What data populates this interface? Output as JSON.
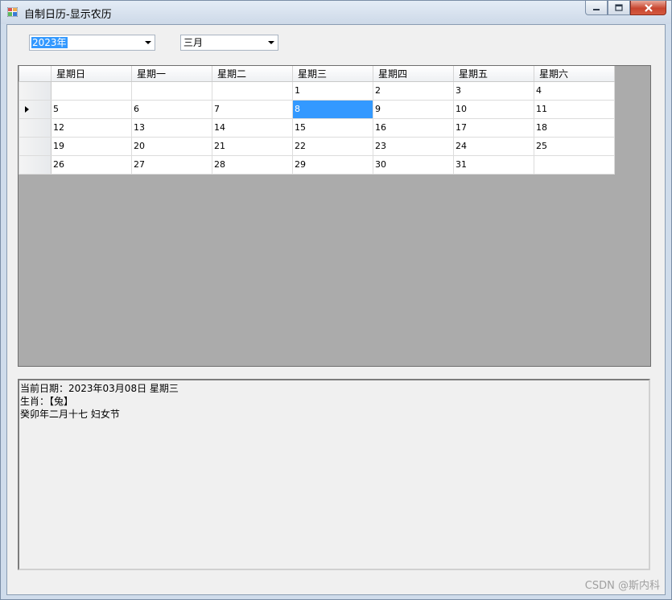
{
  "window": {
    "title": "自制日历-显示农历",
    "controls": {
      "minimize_icon": "minimize-icon",
      "maximize_icon": "maximize-icon",
      "close_icon": "close-icon"
    }
  },
  "year_combo": {
    "value": "2023年"
  },
  "month_combo": {
    "value": "三月"
  },
  "calendar": {
    "headers": [
      "星期日",
      "星期一",
      "星期二",
      "星期三",
      "星期四",
      "星期五",
      "星期六"
    ],
    "rows": [
      [
        "",
        "",
        "",
        "1",
        "2",
        "3",
        "4"
      ],
      [
        "5",
        "6",
        "7",
        "8",
        "9",
        "10",
        "11"
      ],
      [
        "12",
        "13",
        "14",
        "15",
        "16",
        "17",
        "18"
      ],
      [
        "19",
        "20",
        "21",
        "22",
        "23",
        "24",
        "25"
      ],
      [
        "26",
        "27",
        "28",
        "29",
        "30",
        "31",
        ""
      ]
    ],
    "selected_value": "8"
  },
  "info": {
    "line1": "当前日期：2023年03月08日 星期三",
    "line2": "生肖：【兔】",
    "line3": "癸卯年二月十七 妇女节"
  },
  "watermark": "CSDN @斯内科",
  "colors": {
    "selection": "#3399ff",
    "grid_background": "#ababab"
  }
}
